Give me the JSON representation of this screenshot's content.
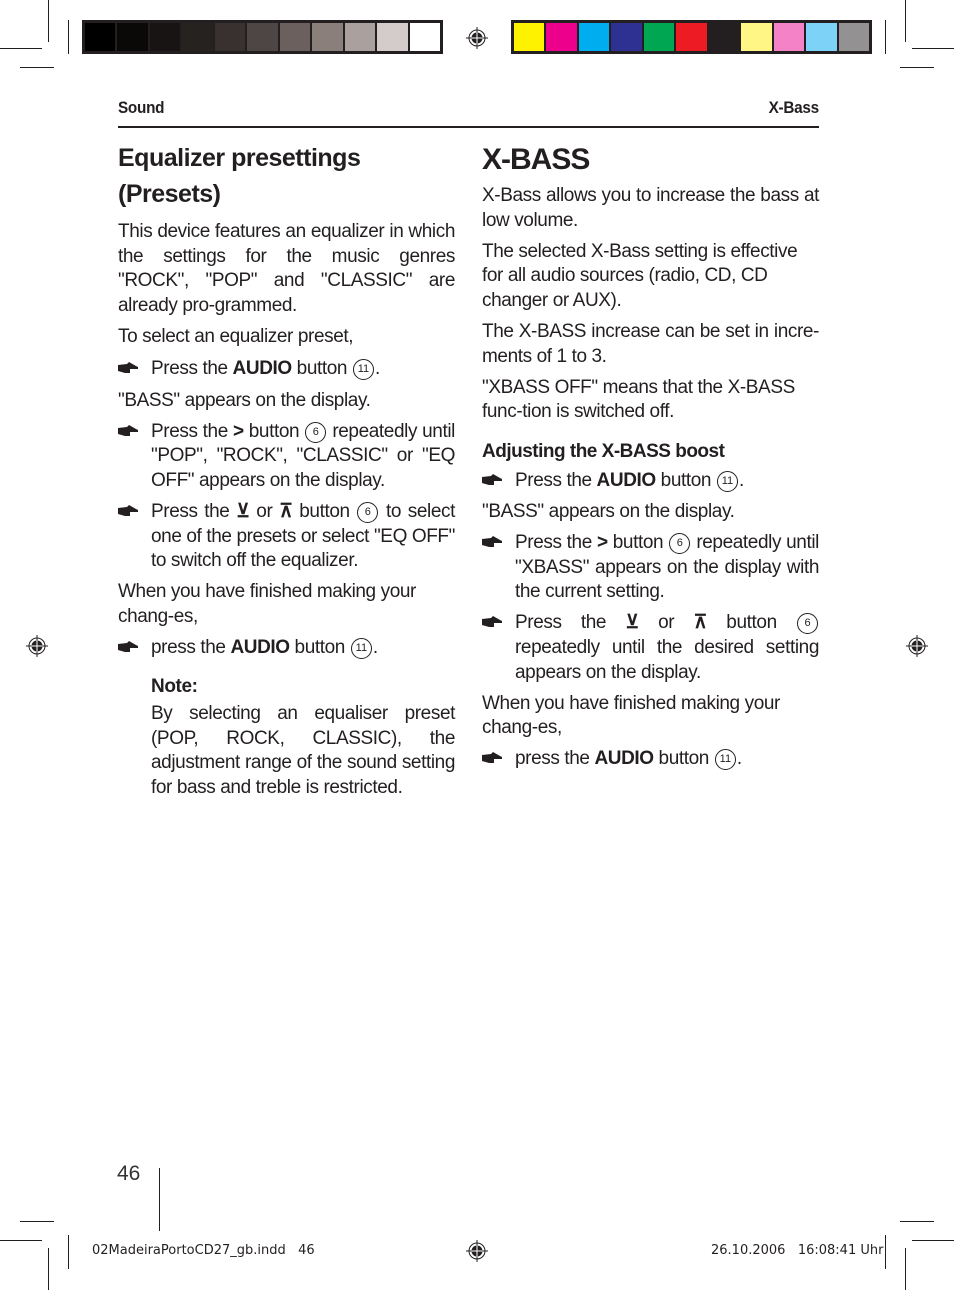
{
  "print_marks": {
    "grayscale_swatches": [
      "#000000",
      "#0b0908",
      "#171413",
      "#262220",
      "#383130",
      "#4e4644",
      "#6b605d",
      "#8a7f7b",
      "#aaa19e",
      "#d4ccca",
      "#ffffff"
    ],
    "color_swatches": [
      "#fff200",
      "#ec008c",
      "#00aeef",
      "#2e3192",
      "#00a651",
      "#ed1c24",
      "#231f20",
      "#fff685",
      "#f482c6",
      "#7dd3f7",
      "#939191"
    ]
  },
  "header": {
    "left": "Sound",
    "right": "X-Bass"
  },
  "left_column": {
    "title": "Equalizer presettings (Presets)",
    "intro": "This device features an equalizer in which the settings for the music genres \"ROCK\", \"POP\" and \"CLASSIC\" are already pro-grammed.",
    "lead": "To select an equalizer preset,",
    "step1": {
      "pre": "Press the ",
      "bold": "AUDIO",
      "post": " button ",
      "num": "11",
      "end": "."
    },
    "result1": "\"BASS\" appears on the display.",
    "step2": {
      "pre": "Press the ",
      "glyph": ">",
      "mid": " button ",
      "num": "6",
      "post": " repeatedly until \"POP\", \"ROCK\", \"CLASSIC\" or \"EQ OFF\" appears on the display."
    },
    "step3": {
      "pre": "Press the ",
      "glyph_down": "⊻",
      "or": " or ",
      "glyph_up": "⊼",
      "mid": " button ",
      "num": "6",
      "post": " to select one of the presets or select \"EQ OFF\" to switch off the equalizer."
    },
    "finish": "When you have finished making your chang-es,",
    "step4": {
      "pre": "press the ",
      "bold": "AUDIO",
      "post": " button ",
      "num": "11",
      "end": "."
    },
    "note_heading": "Note:",
    "note_text": "By selecting an equaliser preset (POP, ROCK, CLASSIC), the adjustment range of the sound setting for bass and treble is restricted."
  },
  "right_column": {
    "title": "X-BASS",
    "p1": "X-Bass allows you to increase the bass at low volume.",
    "p2": "The selected X-Bass setting is effective for all audio sources (radio, CD, CD changer or AUX).",
    "p3": "The X-BASS increase can be set in incre-ments of 1 to 3.",
    "p4": "\"XBASS OFF\" means that the X-BASS func-tion is switched off.",
    "subheading": "Adjusting the X-BASS boost",
    "step1": {
      "pre": "Press the ",
      "bold": "AUDIO",
      "post": " button ",
      "num": "11",
      "end": "."
    },
    "result1": "\"BASS\" appears on the display.",
    "step2": {
      "pre": "Press the ",
      "glyph": ">",
      "mid": " button ",
      "num": "6",
      "post": " repeatedly until \"XBASS\" appears on the display with the current setting."
    },
    "step3": {
      "pre": "Press the ",
      "glyph_down": "⊻",
      "or": " or ",
      "glyph_up": "⊼",
      "mid": " button ",
      "num": "6",
      "post": " repeatedly until the desired setting appears on the display."
    },
    "finish": "When you have finished making your chang-es,",
    "step4": {
      "pre": "press the ",
      "bold": "AUDIO",
      "post": " button ",
      "num": "11",
      "end": "."
    }
  },
  "footer": {
    "page_number": "46",
    "slug_file": "02MadeiraPortoCD27_gb.indd   46",
    "slug_date": "26.10.2006   16:08:41 Uhr"
  }
}
